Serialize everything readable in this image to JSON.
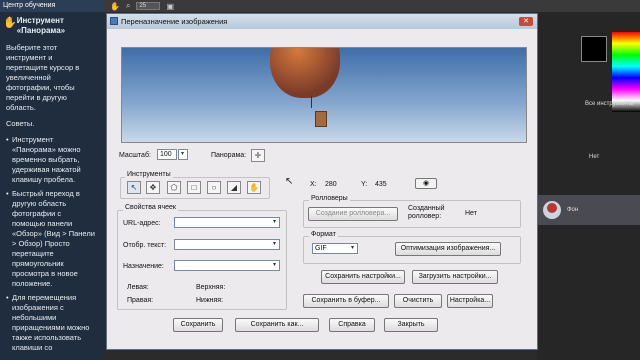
{
  "help": {
    "title": "Центр обучения",
    "heading": "Инструмент «Панорама»",
    "intro": "Выберите этот инструмент и перетащите курсор в увеличенной фотографии, чтобы перейти в другую область.",
    "tips_title": "Советы.",
    "tips": [
      "Инструмент «Панорама» можно временно выбрать, удерживая нажатой клавишу пробела.",
      "Быстрый переход в другую область фотографии с помощью панели «Обзор» (Вид > Панели > Обзор) Просто перетащите прямоугольник просмотра в новое положение.",
      "Для перемещения изображения с небольшими приращениями можно также использовать клавиши со"
    ]
  },
  "toolbar": {
    "zoom_value": "25"
  },
  "right_panel": {
    "show_all_tools": "Все инструменты",
    "no_label": "Нет",
    "layer_name": "Фон"
  },
  "dialog": {
    "title": "Переназначение изображения",
    "close_glyph": "✕",
    "scale_label": "Масштаб:",
    "scale_value": "100",
    "panorama_label": "Панорама:",
    "tools_label": "Инструменты",
    "x_label": "X:",
    "x_value": "280",
    "y_label": "Y:",
    "y_value": "435",
    "cell_props_label": "Свойства ячеек",
    "url_label": "URL-адрес:",
    "alt_text_label": "Отобр. текст:",
    "target_label": "Назначение:",
    "left_label": "Левая:",
    "top_label": "Верхняя:",
    "right_label": "Правая:",
    "bottom_label": "Нижняя:",
    "rollovers_label": "Ролловеры",
    "create_rollover_button": "Создание ролловера...",
    "created_rollover_label": "Созданный ролловер:",
    "created_rollover_value": "Нет",
    "format_label": "Формат",
    "format_value": "GIF",
    "optimize_button": "Оптимизация изображения...",
    "save_settings_button": "Сохранить настройки...",
    "load_settings_button": "Загрузить настройки...",
    "copy_clipboard_button": "Сохранить в буфер...",
    "clear_button": "Очистить",
    "settings_button": "Настройка...",
    "save_button": "Сохранить",
    "save_as_button": "Сохранить как...",
    "help_button": "Справка",
    "close_button": "Закрыть"
  }
}
